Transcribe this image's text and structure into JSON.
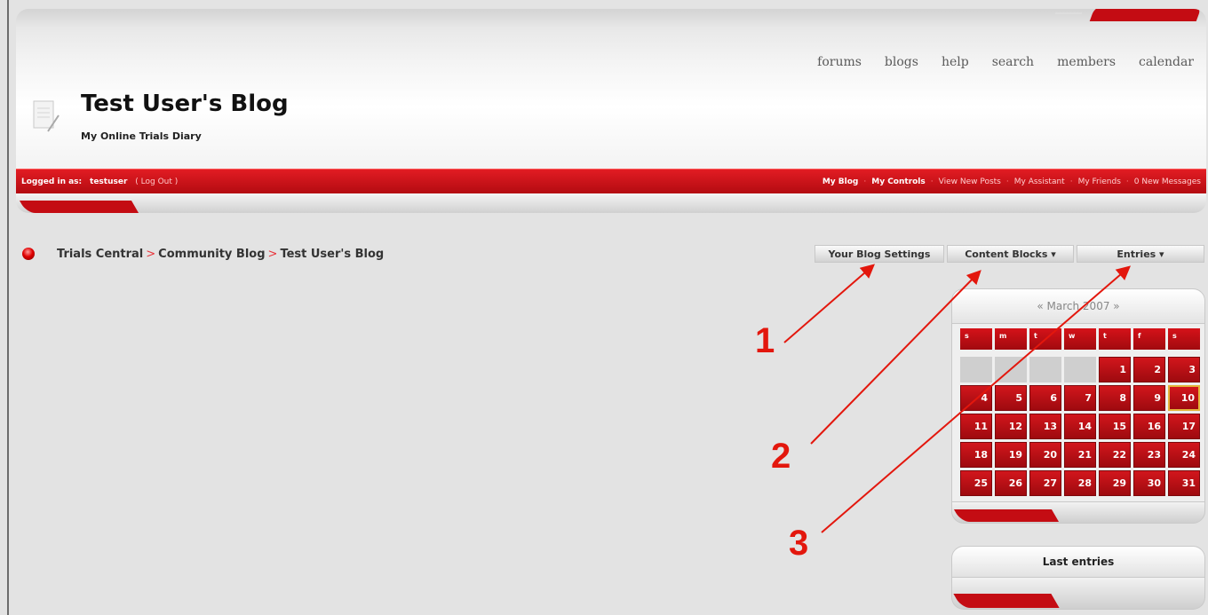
{
  "header": {
    "blog_title": "Test User's Blog",
    "blog_subtitle": "My Online Trials Diary",
    "top_nav": [
      "forums",
      "blogs",
      "help",
      "search",
      "members",
      "calendar"
    ]
  },
  "user_bar": {
    "logged_in_label": "Logged in as:",
    "username": "testuser",
    "logout": "( Log Out )",
    "links": [
      "My Blog",
      "My Controls",
      "View New Posts",
      "My Assistant",
      "My Friends",
      "0 New Messages"
    ]
  },
  "breadcrumb": {
    "items": [
      "Trials Central",
      "Community Blog",
      "Test User's Blog"
    ],
    "separator": ">"
  },
  "tabs": {
    "settings": "Your Blog Settings",
    "content_blocks": "Content Blocks ▾",
    "entries": "Entries ▾"
  },
  "calendar": {
    "title": "« March 2007 »",
    "weekdays": [
      "s",
      "m",
      "t",
      "w",
      "t",
      "f",
      "s"
    ],
    "leading_blanks": 4,
    "days": [
      "1",
      "2",
      "3",
      "4",
      "5",
      "6",
      "7",
      "8",
      "9",
      "10",
      "11",
      "12",
      "13",
      "14",
      "15",
      "16",
      "17",
      "18",
      "19",
      "20",
      "21",
      "22",
      "23",
      "24",
      "25",
      "26",
      "27",
      "28",
      "29",
      "30",
      "31"
    ],
    "highlighted_day": "10"
  },
  "last_entries": {
    "title": "Last entries"
  },
  "annotations": [
    "1",
    "2",
    "3"
  ],
  "colors": {
    "brand_red": "#c40c13",
    "annotation_red": "#e3170d",
    "today_border": "#e3b43a"
  }
}
